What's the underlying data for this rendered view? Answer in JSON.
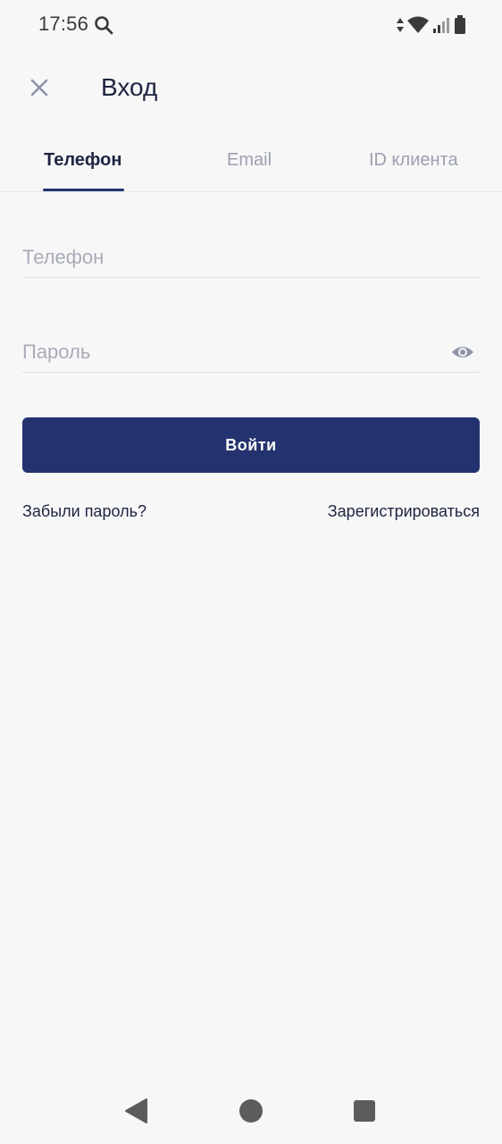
{
  "status_bar": {
    "time": "17:56",
    "icons": [
      "search-icon",
      "data-arrows-icon",
      "wifi-icon",
      "signal-icon",
      "battery-icon"
    ]
  },
  "header": {
    "title": "Вход",
    "close_icon": "close-icon"
  },
  "tabs": [
    {
      "label": "Телефон",
      "active": true
    },
    {
      "label": "Email",
      "active": false
    },
    {
      "label": "ID клиента",
      "active": false
    }
  ],
  "form": {
    "phone": {
      "placeholder": "Телефон",
      "value": ""
    },
    "password": {
      "placeholder": "Пароль",
      "value": ""
    },
    "submit_label": "Войти"
  },
  "links": {
    "forgot_password": "Забыли пароль?",
    "register": "Зарегистрироваться"
  },
  "colors": {
    "primary": "#24336f",
    "text": "#1e2440",
    "muted": "#9ba0b0",
    "background": "#f7f7f8"
  },
  "nav_bar": {
    "icons": [
      "back-icon",
      "home-icon",
      "recents-icon"
    ]
  }
}
